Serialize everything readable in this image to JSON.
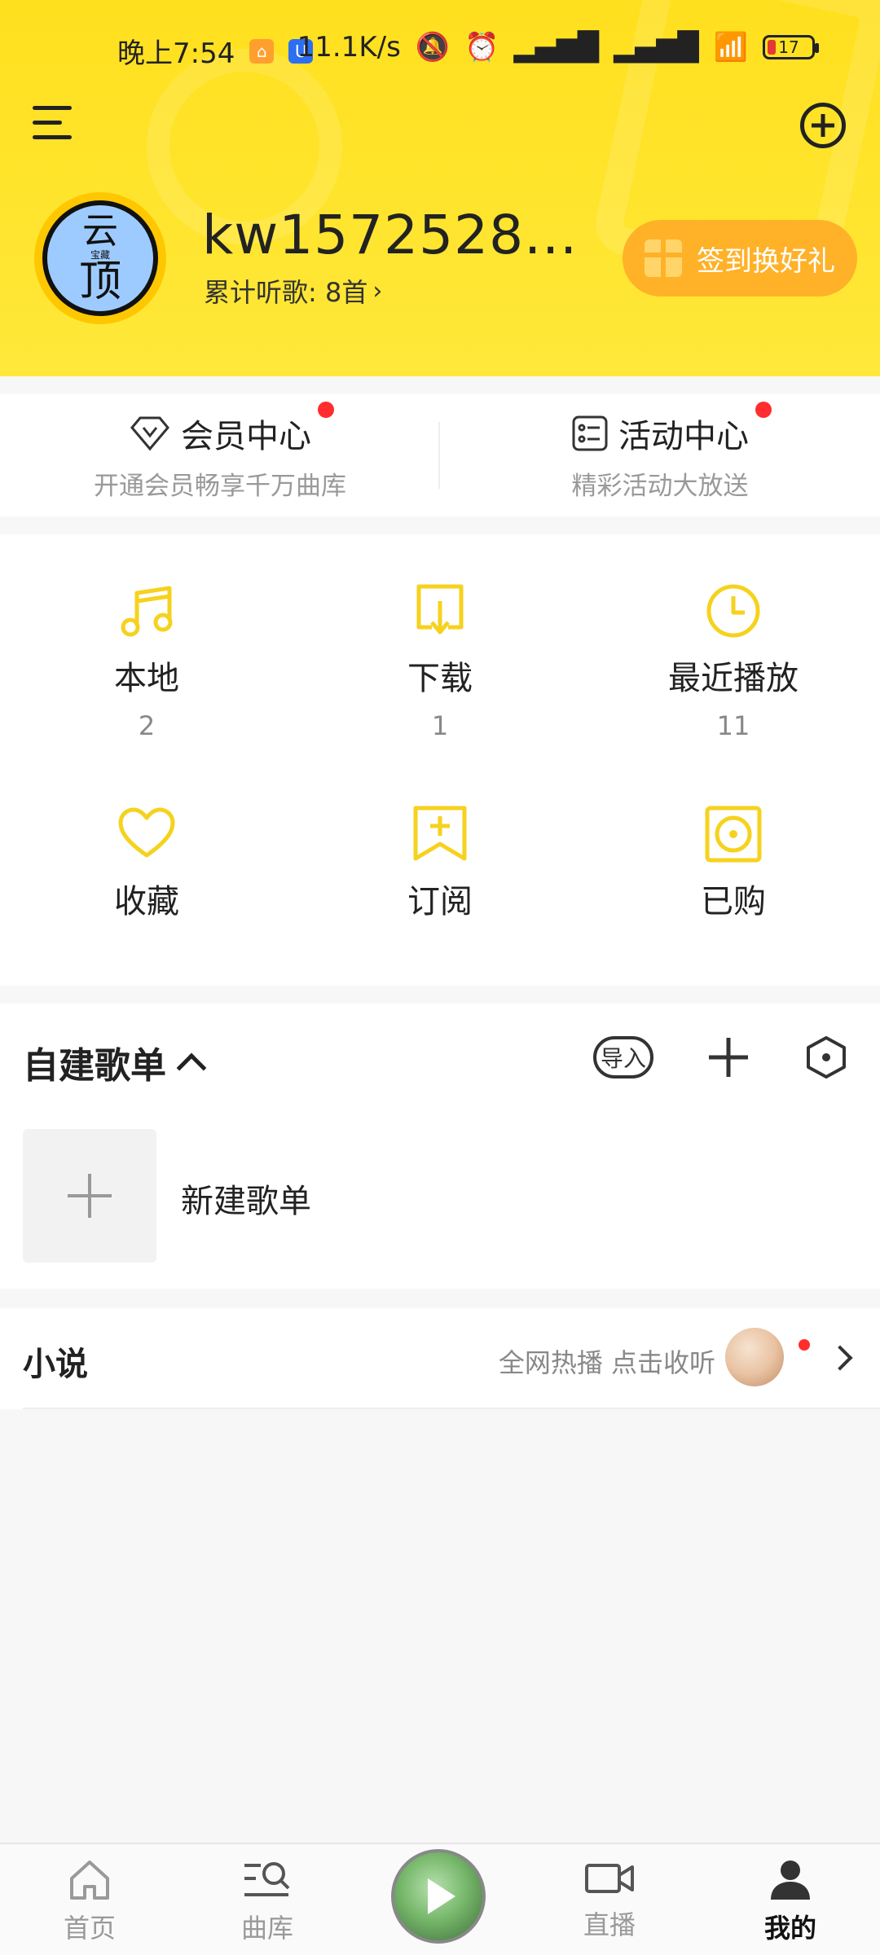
{
  "status": {
    "time": "晚上7:54",
    "net_speed": "11.1K/s",
    "battery": "17"
  },
  "profile": {
    "username": "kw1572528...",
    "avatar_text_top": "云",
    "avatar_text_mid": "宝藏",
    "avatar_text_bottom": "顶",
    "listen_label": "累计听歌: 8首",
    "signin_label": "签到换好礼"
  },
  "member": {
    "title": "会员中心",
    "subtitle": "开通会员畅享千万曲库"
  },
  "activity": {
    "title": "活动中心",
    "subtitle": "精彩活动大放送"
  },
  "grid": [
    {
      "label": "本地",
      "count": "2",
      "icon": "music-note-icon"
    },
    {
      "label": "下载",
      "count": "1",
      "icon": "download-icon"
    },
    {
      "label": "最近播放",
      "count": "11",
      "icon": "clock-icon"
    },
    {
      "label": "收藏",
      "count": "",
      "icon": "heart-icon"
    },
    {
      "label": "订阅",
      "count": "",
      "icon": "bookmark-plus-icon"
    },
    {
      "label": "已购",
      "count": "",
      "icon": "disc-icon"
    }
  ],
  "playlist": {
    "title": "自建歌单",
    "import_label": "导入",
    "new_label": "新建歌单"
  },
  "novel": {
    "title": "小说",
    "desc": "全网热播 点击收听"
  },
  "nav": [
    {
      "label": "首页",
      "icon": "home-icon"
    },
    {
      "label": "曲库",
      "icon": "library-search-icon"
    },
    {
      "label": "",
      "icon": "play-icon"
    },
    {
      "label": "直播",
      "icon": "video-camera-icon"
    },
    {
      "label": "我的",
      "icon": "user-icon"
    }
  ],
  "colors": {
    "accent": "#FFE01E",
    "icon_yellow": "#F6D21E",
    "signin_bg": "#FFB128",
    "red_dot": "#FF2D2D"
  }
}
